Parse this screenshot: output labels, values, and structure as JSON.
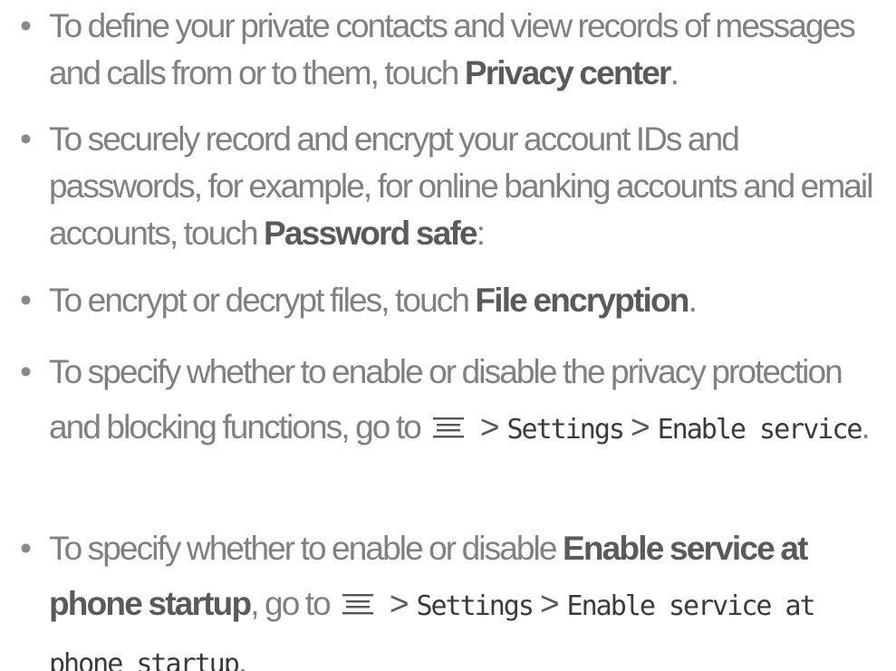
{
  "bullet_glyph": "•",
  "items": [
    {
      "text_before": "To define your private contacts and view records of messages and calls from or to them, touch ",
      "bold": "Privacy center",
      "text_after": "."
    },
    {
      "text_before": "To securely record and encrypt your account IDs and passwords, for example, for online banking accounts and email accounts, touch ",
      "bold": "Password safe",
      "text_after": ":"
    },
    {
      "text_before": "To encrypt or decrypt files, touch ",
      "bold": "File encryption",
      "text_after": "."
    },
    {
      "text_before": "To specify whether to enable or disable the privacy protection and blocking functions, go to",
      "menu_icon": "menu-icon",
      "sep1": ">",
      "path1": "Settings",
      "sep2": ">",
      "path2": "Enable service",
      "text_after": "."
    },
    {
      "text_before": "To specify whether to enable or disable ",
      "bold": "Enable service at phone startup",
      "text_mid": ", go to",
      "menu_icon": "menu-icon",
      "sep1": ">",
      "path1": "Settings",
      "sep2": ">",
      "path2": "Enable service at phone startup",
      "text_after": "."
    }
  ]
}
